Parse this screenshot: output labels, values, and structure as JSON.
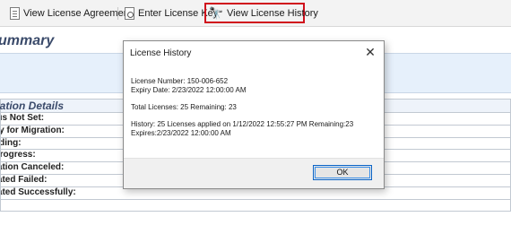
{
  "toolbar": {
    "items": [
      {
        "label": "View License Agreement",
        "icon": "document-icon"
      },
      {
        "label": "Enter License Key",
        "icon": "key-document-icon"
      },
      {
        "label": "View License History",
        "icon": "binoculars-icon",
        "highlight_color": "#d0101c"
      }
    ]
  },
  "page": {
    "summary_title": "ummary"
  },
  "migration": {
    "header": "ration Details",
    "rows": [
      "tus Not Set:",
      "dy for Migration:",
      "nding:",
      "Progress:",
      "ration Canceled:",
      "rated Failed:",
      "rated Successfully:",
      ":"
    ]
  },
  "dialog": {
    "title": "License History",
    "license_number": "License Number: 150-006-652",
    "expiry_date": "Expiry Date: 2/23/2022 12:00:00 AM",
    "totals": "Total Licenses: 25 Remaining: 23",
    "history_line1": "History: 25 Licenses applied on 1/12/2022 12:55:27 PM Remaining:23",
    "history_line2": "Expires:2/23/2022 12:00:00 AM",
    "ok_label": "OK"
  }
}
